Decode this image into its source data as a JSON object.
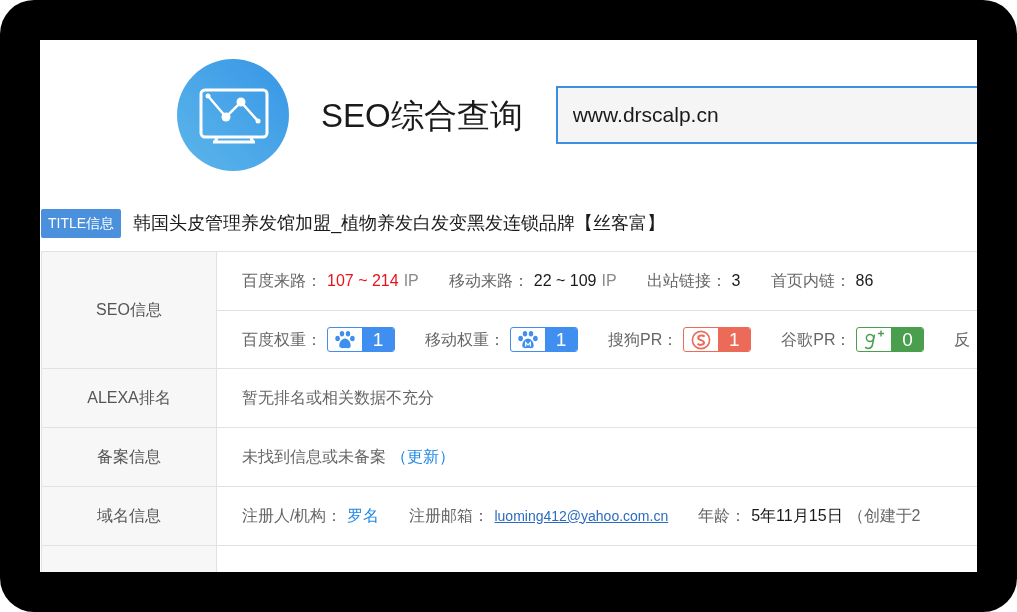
{
  "header": {
    "title": "SEO综合查询",
    "url_field": {
      "value": "www.drscalp.cn"
    }
  },
  "site_title": {
    "tag": "TITLE信息",
    "text": "韩国头皮管理养发馆加盟_植物养发白发变黑发连锁品牌【丝客富】"
  },
  "rows": [
    {
      "label": "SEO信息",
      "lines": [
        {
          "groups": [
            {
              "parts": [
                {
                  "kind": "label",
                  "text": "百度来路："
                },
                {
                  "kind": "range",
                  "text": "107 ~ 214"
                },
                {
                  "kind": "unit",
                  "text": "IP"
                }
              ]
            },
            {
              "parts": [
                {
                  "kind": "label",
                  "text": "移动来路："
                },
                {
                  "kind": "value",
                  "text": "22 ~ 109"
                },
                {
                  "kind": "unit",
                  "text": "IP"
                }
              ]
            },
            {
              "parts": [
                {
                  "kind": "label",
                  "text": "出站链接："
                },
                {
                  "kind": "value",
                  "text": "3"
                }
              ]
            },
            {
              "parts": [
                {
                  "kind": "label",
                  "text": "首页内链："
                },
                {
                  "kind": "value",
                  "text": "86"
                }
              ]
            }
          ]
        },
        {
          "groups": [
            {
              "parts": [
                {
                  "kind": "label",
                  "text": "百度权重："
                },
                {
                  "kind": "baidu",
                  "color": "#3f8ef0",
                  "text": "1"
                }
              ]
            },
            {
              "parts": [
                {
                  "kind": "label",
                  "text": "移动权重："
                },
                {
                  "kind": "mobile",
                  "color": "#3f8ef0",
                  "text": "1"
                }
              ]
            },
            {
              "parts": [
                {
                  "kind": "label",
                  "text": "搜狗PR："
                },
                {
                  "kind": "sogou",
                  "color": "#ec6a58",
                  "text": "1"
                }
              ]
            },
            {
              "parts": [
                {
                  "kind": "label",
                  "text": "谷歌PR："
                },
                {
                  "kind": "google",
                  "color": "#4a9f4e",
                  "text": "0"
                }
              ]
            },
            {
              "parts": [
                {
                  "kind": "label",
                  "text": "反"
                }
              ]
            }
          ]
        }
      ]
    },
    {
      "label": "ALEXA排名",
      "lines": [
        {
          "groups": [
            {
              "parts": [
                {
                  "kind": "label",
                  "text": "暂无排名或相关数据不充分"
                }
              ]
            }
          ]
        }
      ]
    },
    {
      "label": "备案信息",
      "lines": [
        {
          "groups": [
            {
              "parts": [
                {
                  "kind": "label",
                  "text": "未找到信息或未备案"
                },
                {
                  "kind": "link",
                  "text": "（更新）"
                }
              ]
            }
          ]
        }
      ]
    },
    {
      "label": "域名信息",
      "lines": [
        {
          "groups": [
            {
              "parts": [
                {
                  "kind": "label",
                  "text": "注册人/机构："
                },
                {
                  "kind": "link",
                  "text": "罗名"
                }
              ]
            },
            {
              "parts": [
                {
                  "kind": "label",
                  "text": "注册邮箱："
                },
                {
                  "kind": "email",
                  "text": "luoming412@yahoo.com.cn"
                }
              ]
            },
            {
              "parts": [
                {
                  "kind": "label",
                  "text": "年龄："
                },
                {
                  "kind": "value",
                  "text": "5年11月15日"
                },
                {
                  "kind": "label",
                  "text": "（创建于2"
                }
              ]
            }
          ]
        }
      ]
    },
    {
      "lines": []
    }
  ]
}
